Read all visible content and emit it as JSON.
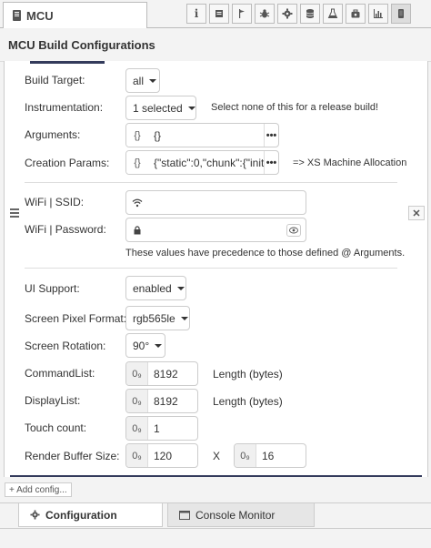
{
  "window": {
    "title": "MCU"
  },
  "toolbar": {
    "icons": [
      "info-icon",
      "book-icon",
      "flag-icon",
      "bug-icon",
      "gear-icon",
      "database-icon",
      "flask-icon",
      "suitcase-icon",
      "chart-icon",
      "mcu-icon"
    ]
  },
  "header": {
    "title": "MCU Build Configurations"
  },
  "form": {
    "build_target": {
      "label": "Build Target:",
      "value": "all"
    },
    "instrumentation": {
      "label": "Instrumentation:",
      "value": "1 selected",
      "note": "Select none of this for a release build!"
    },
    "arguments": {
      "label": "Arguments:",
      "prefix": "{}",
      "value": "{}",
      "more": "•••"
    },
    "creation_params": {
      "label": "Creation Params:",
      "prefix": "{}",
      "value": "{\"static\":0,\"chunk\":{\"initial\":",
      "more": "•••",
      "note": "=> XS Machine Allocation"
    },
    "wifi_ssid": {
      "label": "WiFi | SSID:",
      "value": ""
    },
    "wifi_password": {
      "label": "WiFi | Password:",
      "value": ""
    },
    "wifi_note": "These values have precedence to those defined @ Arguments.",
    "ui_support": {
      "label": "UI Support:",
      "value": "enabled"
    },
    "pixel_format": {
      "label": "Screen Pixel Format:",
      "value": "rgb565le"
    },
    "rotation": {
      "label": "Screen Rotation:",
      "value": "90°"
    },
    "command_list": {
      "label": "CommandList:",
      "prefix": "0₉",
      "value": "8192",
      "unit": "Length (bytes)"
    },
    "display_list": {
      "label": "DisplayList:",
      "prefix": "0₉",
      "value": "8192",
      "unit": "Length (bytes)"
    },
    "touch_count": {
      "label": "Touch count:",
      "prefix": "0₉",
      "value": "1"
    },
    "render_buffer": {
      "label": "Render Buffer Size:",
      "prefix": "0₉",
      "width": "120",
      "x": "X",
      "height": "16"
    }
  },
  "add_config": {
    "label": "+ Add config..."
  },
  "bottom_tabs": {
    "configuration": "Configuration",
    "console_monitor": "Console Monitor"
  }
}
